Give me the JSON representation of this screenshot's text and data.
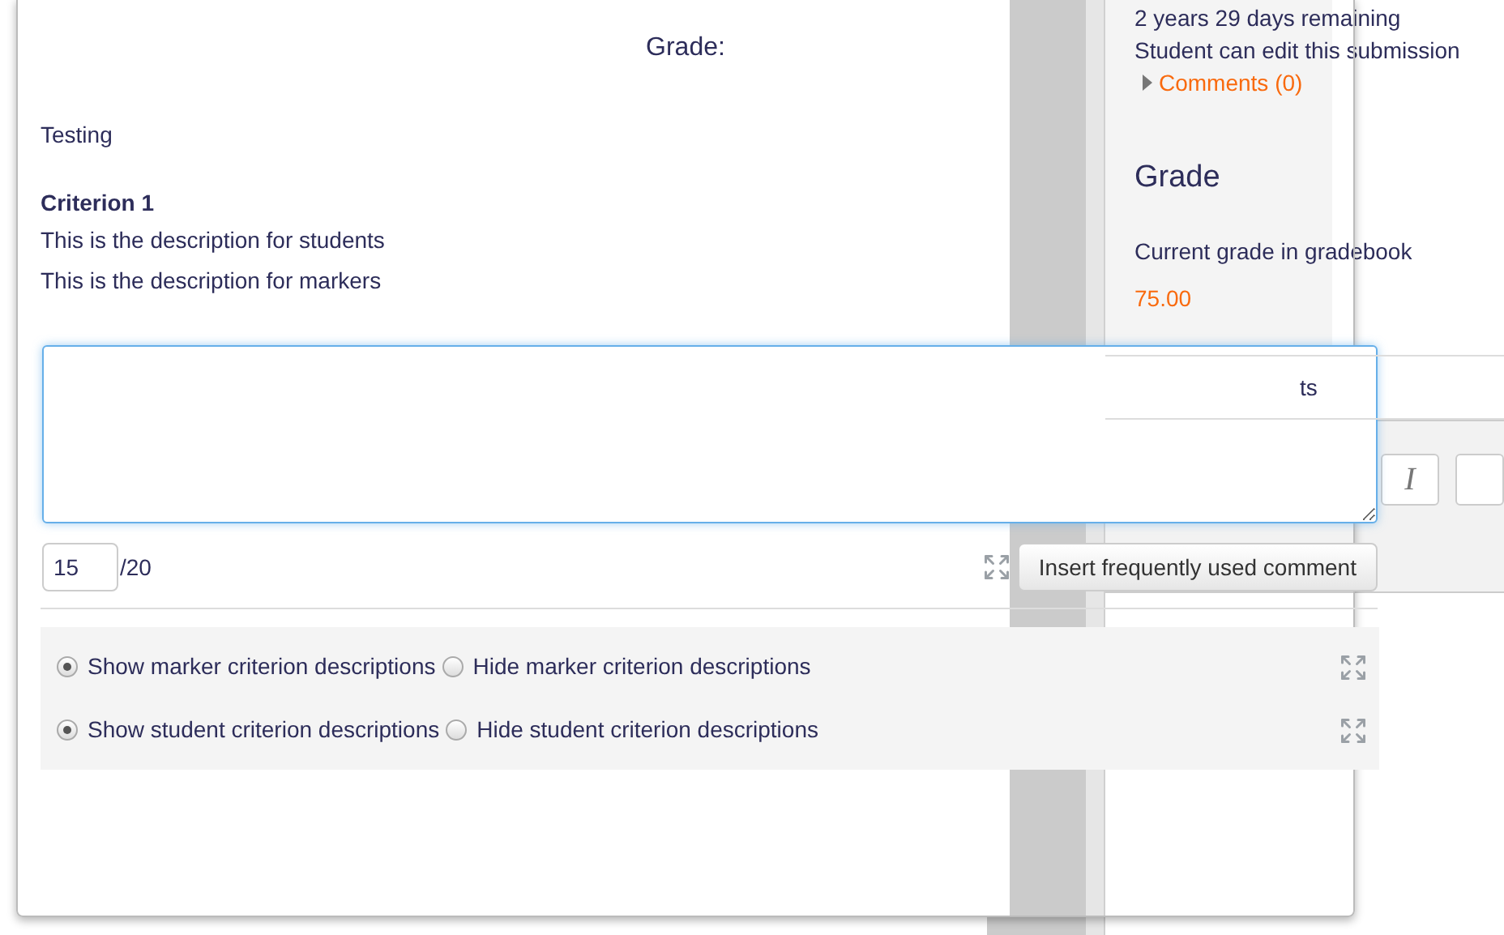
{
  "sidebar": {
    "time_remaining": "2 years 29 days remaining",
    "edit_status": "Student can edit this submission",
    "comments": {
      "label": "Comments (0)",
      "expanded": false
    },
    "heading": "Grade",
    "current_grade_label": "Current grade in gradebook",
    "current_grade": "75.00",
    "field_fragment": "ts",
    "toolbar": [
      "I"
    ]
  },
  "dialog": {
    "title": "Grade:",
    "response": "Testing",
    "criterion": {
      "name": "Criterion 1",
      "student_description": "This is the description for students",
      "marker_description": "This is the description for markers"
    },
    "score": {
      "value": "15",
      "max": "/20"
    },
    "insert_button": "Insert frequently used comment",
    "radio_groups": [
      {
        "options": [
          {
            "label": "Show marker criterion descriptions",
            "selected": true
          },
          {
            "label": "Hide marker criterion descriptions",
            "selected": false
          }
        ]
      },
      {
        "options": [
          {
            "label": "Show student criterion descriptions",
            "selected": true
          },
          {
            "label": "Hide student criterion descriptions",
            "selected": false
          }
        ]
      }
    ]
  }
}
